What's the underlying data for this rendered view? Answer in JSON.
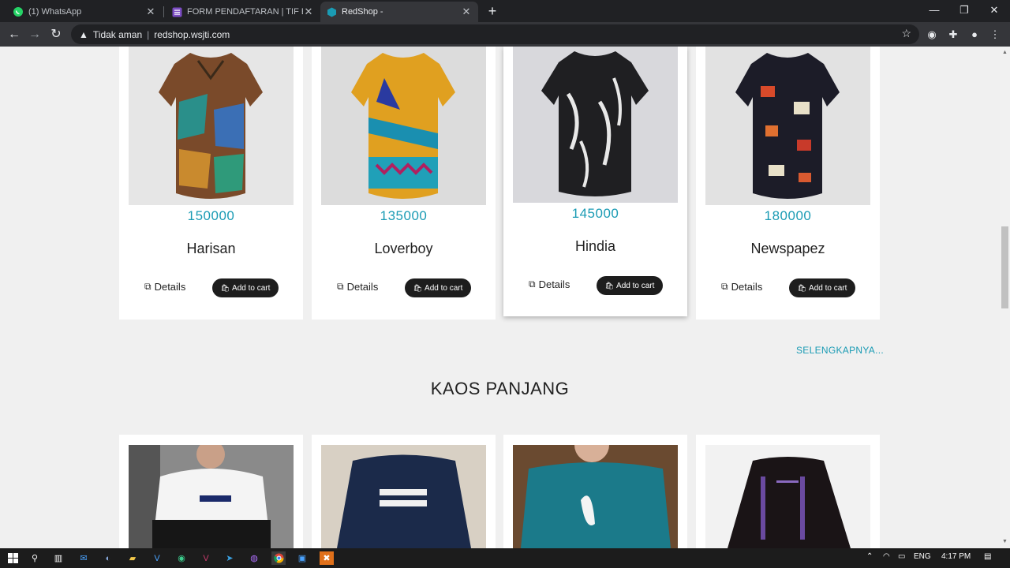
{
  "browser": {
    "tabs": [
      {
        "title": "(1) WhatsApp",
        "icon": "whatsapp-icon",
        "color": "#25d366"
      },
      {
        "title": "FORM PENDAFTARAN | TIF EXHIB",
        "icon": "forms-icon",
        "color": "#7b4cc2"
      },
      {
        "title": "RedShop -",
        "icon": "redshop-icon",
        "color": "#1a9bb4"
      }
    ],
    "security": "Tidak aman",
    "url": "redshop.wsjti.com"
  },
  "products_top": [
    {
      "price": "150000",
      "name": "Harisan"
    },
    {
      "price": "135000",
      "name": "Loverboy"
    },
    {
      "price": "145000",
      "name": "Hindia"
    },
    {
      "price": "180000",
      "name": "Newspapez"
    }
  ],
  "labels": {
    "details": "Details",
    "add_to_cart": "Add to cart"
  },
  "more_link": "SELENGKAPNYA...",
  "section_title": "KAOS PANJANG",
  "taskbar": {
    "lang": "ENG",
    "time": "4:17 PM"
  },
  "colors": {
    "accent": "#1a9bb4",
    "button": "#1d1d1d"
  }
}
